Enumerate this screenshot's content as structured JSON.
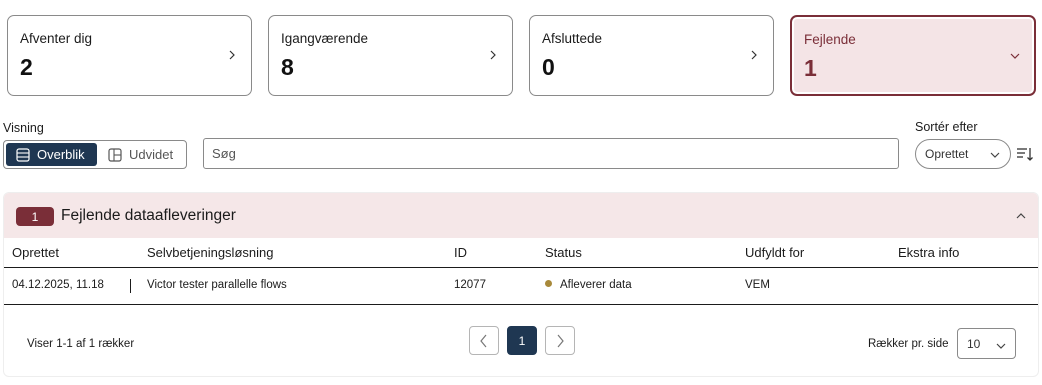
{
  "cards": [
    {
      "label": "Afventer dig",
      "count": "2"
    },
    {
      "label": "Igangværende",
      "count": "8"
    },
    {
      "label": "Afsluttede",
      "count": "0"
    },
    {
      "label": "Fejlende",
      "count": "1"
    }
  ],
  "view": {
    "label": "Visning",
    "options": [
      {
        "label": "Overblik",
        "icon": "list-icon",
        "selected": true
      },
      {
        "label": "Udvidet",
        "icon": "layout-icon",
        "selected": false
      }
    ]
  },
  "search": {
    "placeholder": "Søg",
    "value": ""
  },
  "sort": {
    "label": "Sortér efter",
    "value": "Oprettet",
    "direction_icon": "sort-descending-icon"
  },
  "colors": {
    "accent": "#1f3752",
    "error": "#7a2e38",
    "error_bg": "#f5e7e8",
    "status_dot": "#a8893a"
  },
  "panel": {
    "badge": "1",
    "title": "Fejlende dataafleveringer",
    "columns": [
      "Oprettet",
      "Selvbetjeningsløsning",
      "ID",
      "Status",
      "Udfyldt for",
      "Ekstra info"
    ],
    "rows": [
      {
        "created": "04.12.2025, 11.18",
        "solution": "Victor tester parallelle flows",
        "id": "12077",
        "status": "Afleverer data",
        "filled_for": "VEM",
        "extra": ""
      }
    ]
  },
  "pagination": {
    "info": "Viser 1-1 af 1 rækker",
    "current_page": "1",
    "rows_per_page_label": "Rækker pr. side",
    "rows_per_page": "10"
  }
}
